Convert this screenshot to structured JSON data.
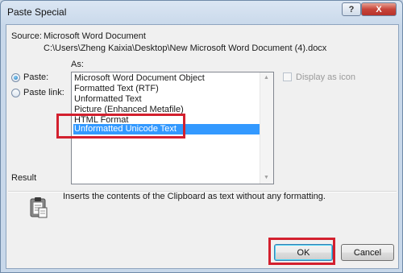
{
  "window": {
    "title": "Paste Special",
    "help_glyph": "?",
    "close_glyph": "X"
  },
  "source": {
    "label": "Source:",
    "name": "Microsoft Word Document",
    "path": "C:\\Users\\Zheng Kaixia\\Desktop\\New Microsoft Word Document (4).docx"
  },
  "paste_options": {
    "as_label": "As:",
    "paste_label": "Paste:",
    "paste_link_label": "Paste link:",
    "selected": "paste"
  },
  "formats": {
    "items": [
      "Microsoft Word Document Object",
      "Formatted Text (RTF)",
      "Unformatted Text",
      "Picture (Enhanced Metafile)",
      "HTML Format",
      "Unformatted Unicode Text"
    ],
    "selected_index": 5
  },
  "display_as_icon": {
    "label": "Display as icon",
    "checked": false,
    "enabled": false
  },
  "result": {
    "label": "Result",
    "description": "Inserts the contents of the Clipboard as text without any formatting."
  },
  "buttons": {
    "ok": "OK",
    "cancel": "Cancel"
  },
  "colors": {
    "annotation": "#d3202e",
    "selection": "#3399ff"
  },
  "icons": {
    "result_icon": "clipboard-icon"
  }
}
